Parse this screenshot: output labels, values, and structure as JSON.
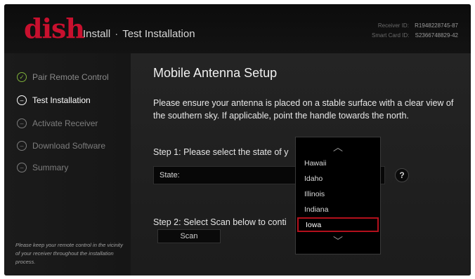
{
  "header": {
    "logo": "dish",
    "title_section": "Install",
    "title_separator": "·",
    "title_page": "Test Installation",
    "receiver_id_label": "Receiver ID:",
    "receiver_id_value": "R1948228745-87",
    "smart_card_label": "Smart Card ID:",
    "smart_card_value": "S2366748829-42"
  },
  "sidebar": {
    "steps": [
      {
        "label": "Pair Remote Control",
        "status": "done",
        "icon": "check-circle-icon",
        "glyph": "✓"
      },
      {
        "label": "Test Installation",
        "status": "active",
        "icon": "dash-circle-icon",
        "glyph": "–"
      },
      {
        "label": "Activate Receiver",
        "status": "pending",
        "icon": "dash-circle-icon",
        "glyph": "–"
      },
      {
        "label": "Download Software",
        "status": "pending",
        "icon": "dash-circle-icon",
        "glyph": "–"
      },
      {
        "label": "Summary",
        "status": "pending",
        "icon": "dash-circle-icon",
        "glyph": "–"
      }
    ],
    "note": "Please keep your remote control in the vicinity of your receiver throughout the installation process."
  },
  "main": {
    "title": "Mobile Antenna Setup",
    "instructions": "Please ensure your antenna is placed on a stable surface with a clear view of the southern sky. If applicable, point the handle towards the north.",
    "step1_label": "Step 1: Please select the state of y",
    "state_field_label": "State:",
    "help_label": "?",
    "step2_label": "Step 2: Select Scan below to conti",
    "scan_label": "Scan"
  },
  "dropdown": {
    "up_glyph": "︿",
    "down_glyph": "﹀",
    "options": [
      "Hawaii",
      "Idaho",
      "Illinois",
      "Indiana",
      "Iowa"
    ],
    "selected_index": 4
  },
  "colors": {
    "brand_red": "#c8102e",
    "done_green": "#7fb13a",
    "selection_border": "#b3101c"
  }
}
